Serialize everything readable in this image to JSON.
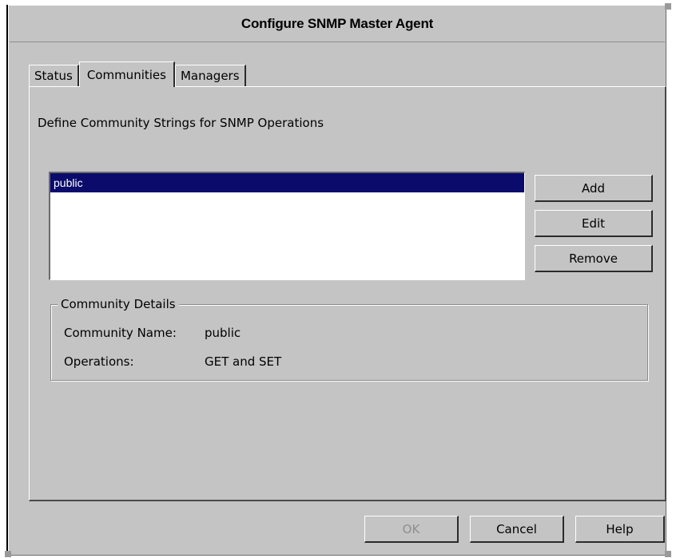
{
  "window": {
    "title": "Configure SNMP Master Agent"
  },
  "tabs": [
    {
      "label": "Status",
      "active": false
    },
    {
      "label": "Communities",
      "active": true
    },
    {
      "label": "Managers",
      "active": false
    }
  ],
  "panel": {
    "description": "Define Community Strings for SNMP Operations",
    "list": {
      "items": [
        "public"
      ],
      "selected": "public"
    },
    "buttons": {
      "add": "Add",
      "edit": "Edit",
      "remove": "Remove"
    },
    "details": {
      "title": "Community Details",
      "name_label": "Community Name:",
      "name_value": "public",
      "ops_label": "Operations:",
      "ops_value": "GET and SET"
    }
  },
  "footer": {
    "ok": "OK",
    "cancel": "Cancel",
    "help": "Help"
  },
  "colors": {
    "selection": "#0a0b6b",
    "window": "#c4c4c4"
  }
}
